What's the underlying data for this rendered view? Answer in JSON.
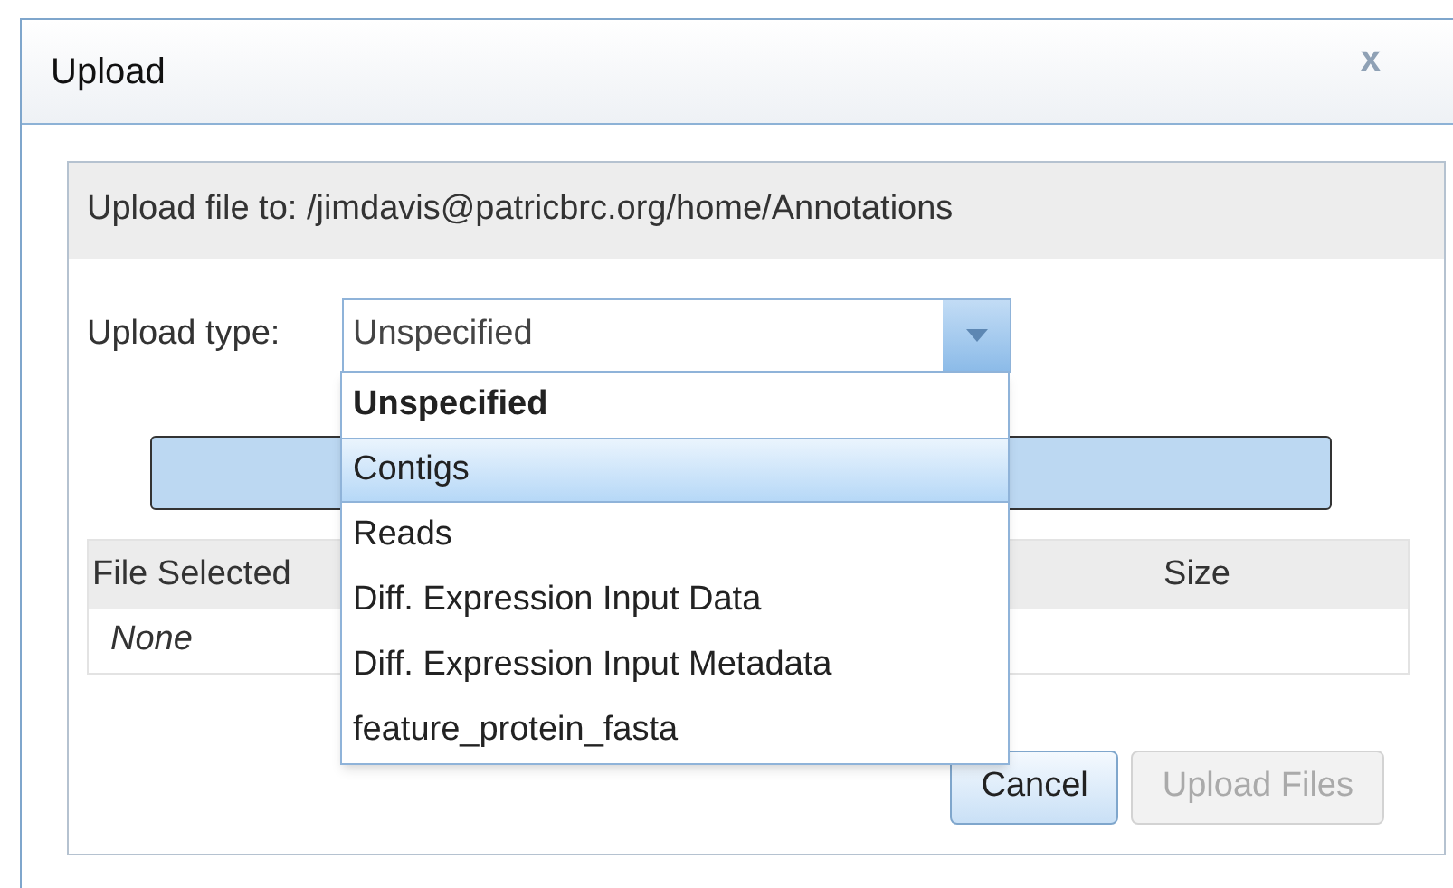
{
  "dialog": {
    "title": "Upload",
    "close": "x"
  },
  "destination": "Upload file to: /jimdavis@patricbrc.org/home/Annotations",
  "upload_type": {
    "label": "Upload type:",
    "value": "Unspecified",
    "expanded": true,
    "options": [
      {
        "label": "Unspecified",
        "selected": true,
        "highlighted": false
      },
      {
        "label": "Contigs",
        "selected": false,
        "highlighted": true
      },
      {
        "label": "Reads",
        "selected": false,
        "highlighted": false
      },
      {
        "label": "Diff. Expression Input Data",
        "selected": false,
        "highlighted": false
      },
      {
        "label": "Diff. Expression Input Metadata",
        "selected": false,
        "highlighted": false
      },
      {
        "label": "feature_protein_fasta",
        "selected": false,
        "highlighted": false
      }
    ]
  },
  "table": {
    "columns": [
      "File Selected",
      "Size"
    ],
    "empty_text": "None"
  },
  "buttons": [
    {
      "label": "Cancel",
      "disabled": false
    },
    {
      "label": "Upload Files",
      "disabled": true
    }
  ]
}
